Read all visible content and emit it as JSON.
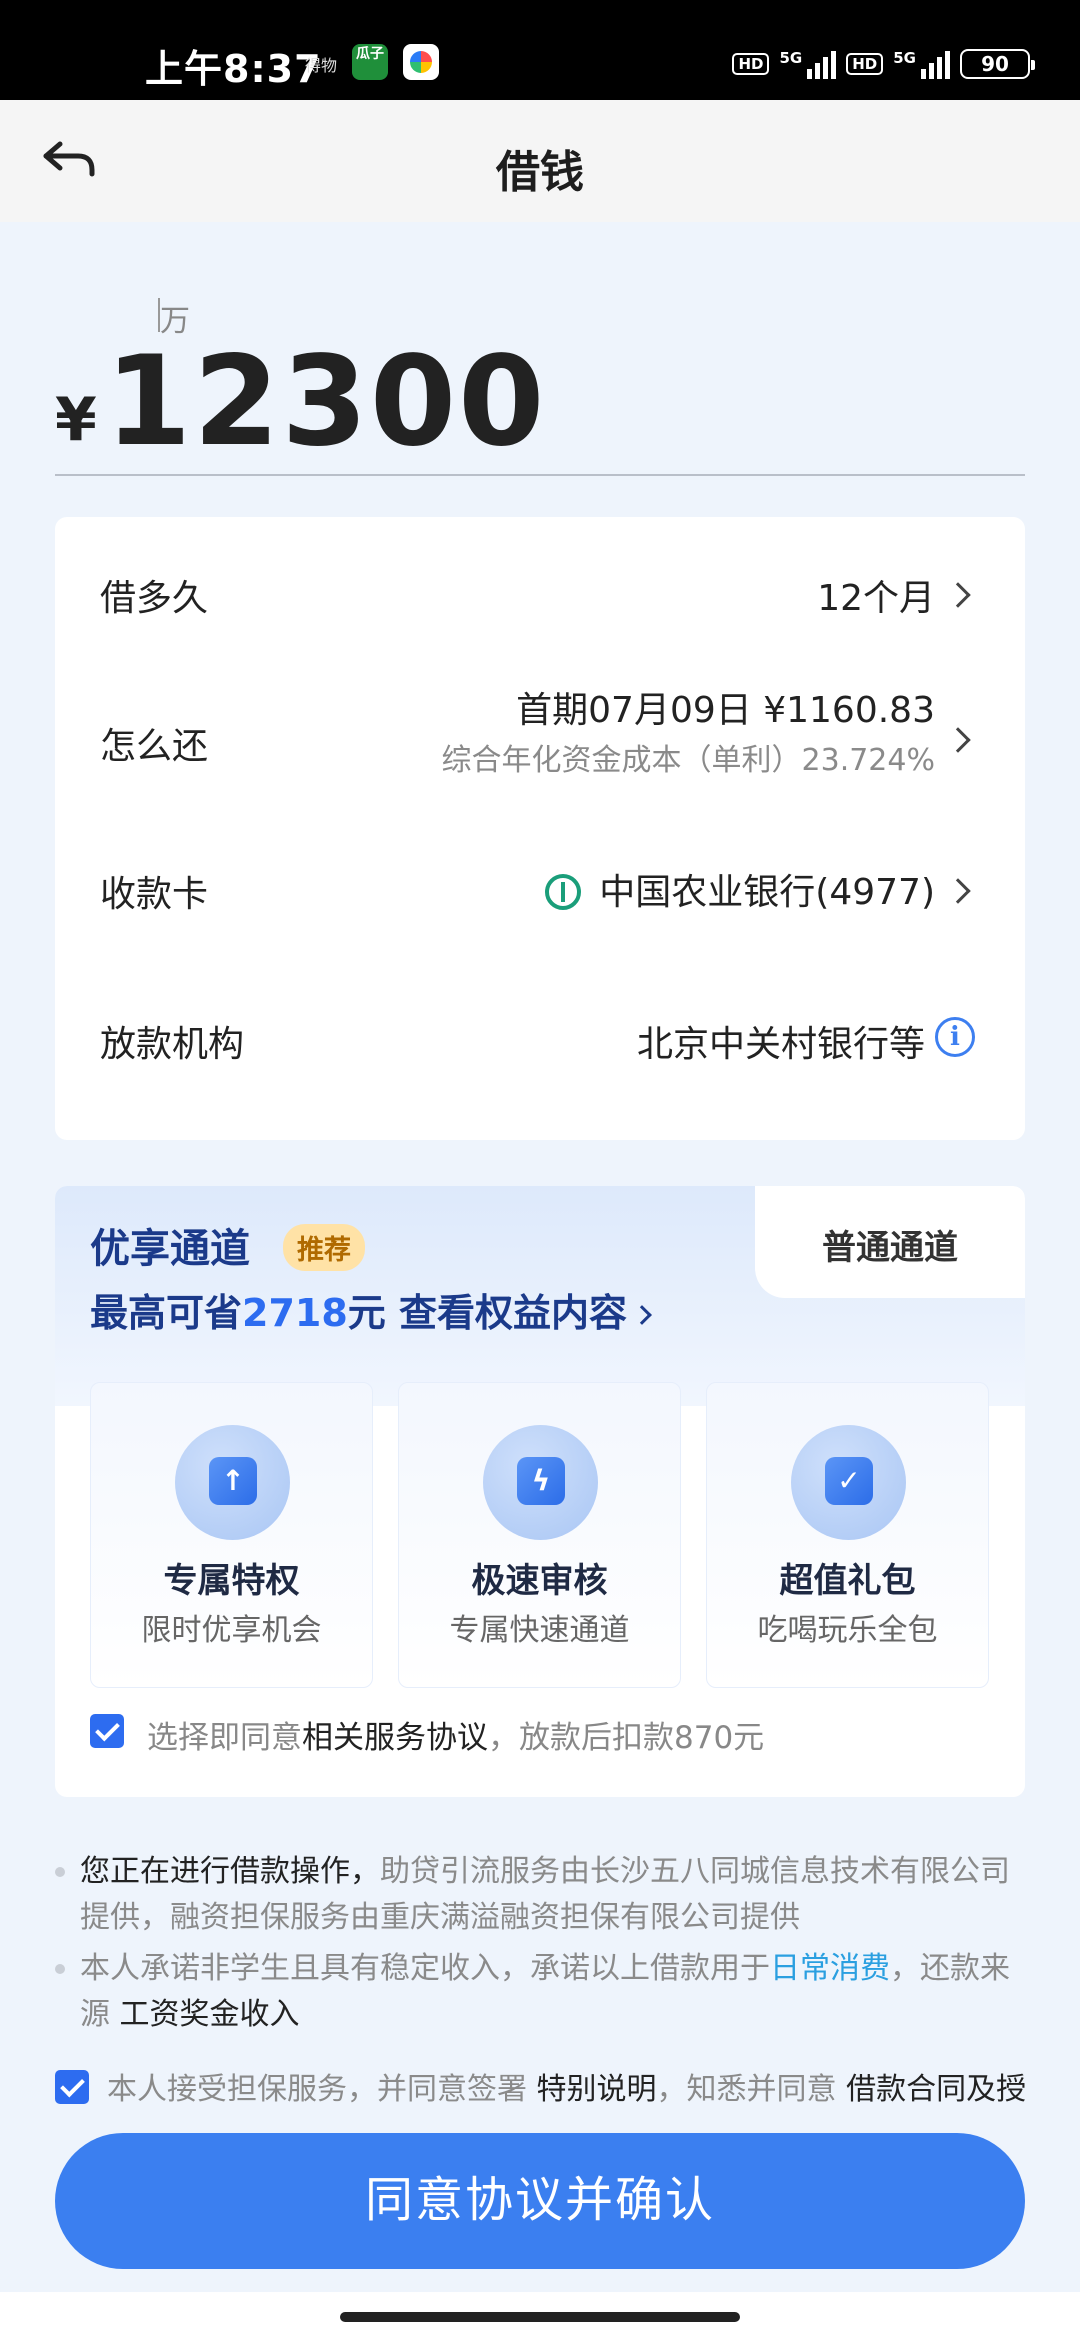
{
  "status_bar": {
    "time": "上午8:37",
    "mini_text": "得物",
    "app_badge_text": "瓜子",
    "hd": "HD",
    "network": "5G",
    "battery": "90"
  },
  "header": {
    "title": "借钱"
  },
  "amount": {
    "unit_hint": "万",
    "currency": "¥",
    "value": "12300"
  },
  "details": {
    "term_label": "借多久",
    "term_value": "12个月",
    "repay_label": "怎么还",
    "repay_value": "首期07月09日 ¥1160.83",
    "repay_sub": "综合年化资金成本（单利）23.724%",
    "card_label": "收款卡",
    "card_value": "中国农业银行(4977)",
    "lender_label": "放款机构",
    "lender_value": "北京中关村银行等"
  },
  "channel": {
    "premium_title": "优享通道",
    "premium_badge": "推荐",
    "normal_tab": "普通通道",
    "save_prefix": "最高可省",
    "save_amount": "2718",
    "save_suffix": "元 查看权益内容",
    "perks": [
      {
        "title": "专属特权",
        "sub": "限时优享机会",
        "glyph": "↑"
      },
      {
        "title": "极速审核",
        "sub": "专属快速通道",
        "glyph": "ϟ"
      },
      {
        "title": "超值礼包",
        "sub": "吃喝玩乐全包",
        "glyph": "✓"
      }
    ],
    "agree_prefix": "选择即同意",
    "agree_link": "相关服务协议",
    "agree_suffix": "，放款后扣款870元"
  },
  "notes": {
    "n1_dark": "您正在进行借款操作，",
    "n1_rest": "助贷引流服务由长沙五八同城信息技术有限公司提供，融资担保服务由重庆满溢融资担保有限公司提供",
    "n2_a": "本人承诺非学生且具有稳定收入，承诺以上借款用于",
    "n2_link": "日常消费",
    "n2_b": "，还款来源 ",
    "n2_dark": "工资奖金收入"
  },
  "bottom_agree": {
    "a": "本人接受担保服务，并同意签署 ",
    "b": "特别说明",
    "c": "，知悉并同意 ",
    "d": "借款合同及授"
  },
  "confirm_button": "同意协议并确认"
}
